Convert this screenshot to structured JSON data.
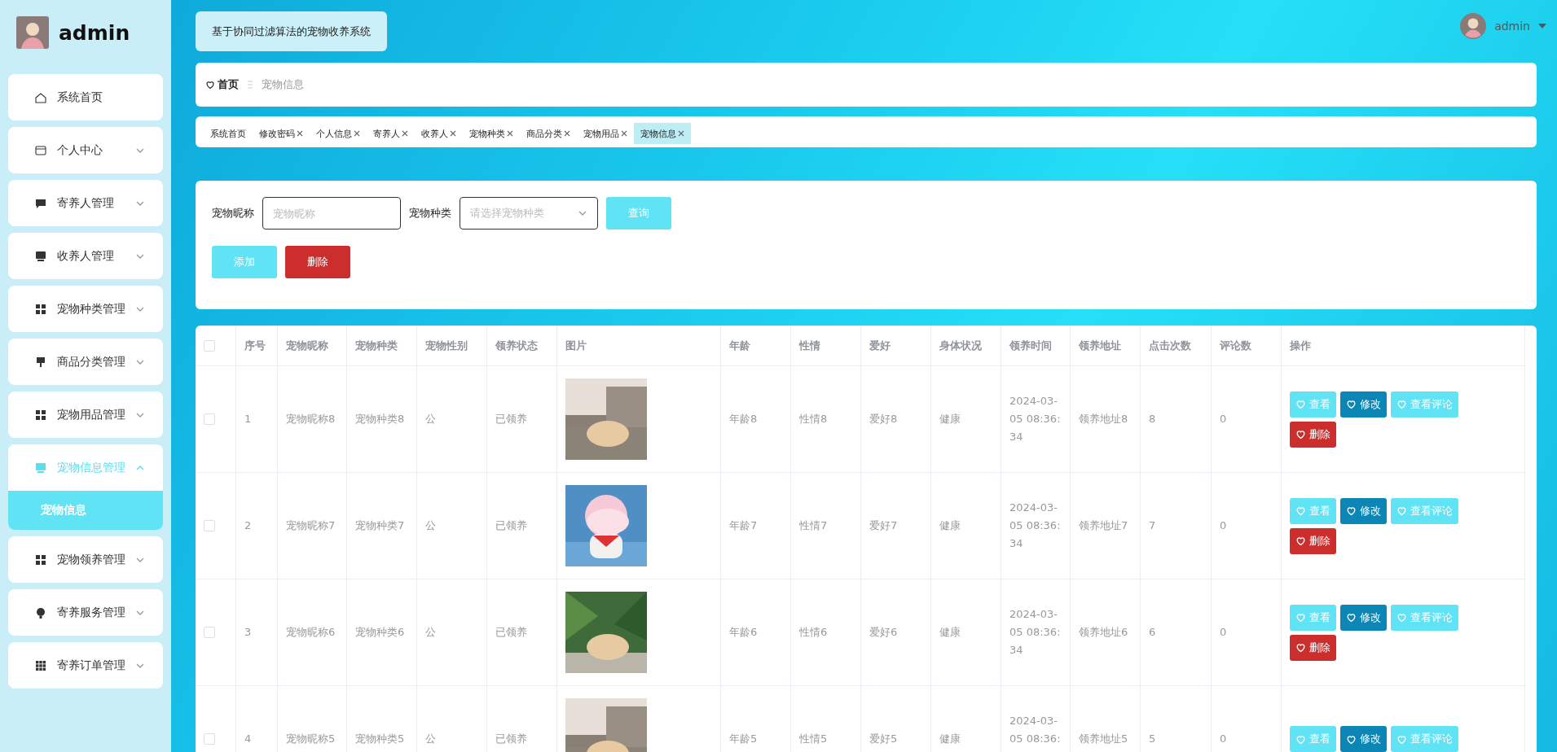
{
  "sidebar": {
    "title": "admin",
    "menu": [
      {
        "label": "系统首页",
        "kind": "link"
      },
      {
        "label": "个人中心",
        "kind": "group",
        "expanded": false
      },
      {
        "label": "寄养人管理",
        "kind": "group",
        "expanded": false
      },
      {
        "label": "收养人管理",
        "kind": "group",
        "expanded": false
      },
      {
        "label": "宠物种类管理",
        "kind": "group",
        "expanded": false
      },
      {
        "label": "商品分类管理",
        "kind": "group",
        "expanded": false
      },
      {
        "label": "宠物用品管理",
        "kind": "group",
        "expanded": false
      },
      {
        "label": "宠物信息管理",
        "kind": "group",
        "expanded": true,
        "children": [
          {
            "label": "宠物信息",
            "selected": true
          }
        ]
      },
      {
        "label": "宠物领养管理",
        "kind": "group",
        "expanded": false
      },
      {
        "label": "寄养服务管理",
        "kind": "group",
        "expanded": false
      },
      {
        "label": "寄养订单管理",
        "kind": "group",
        "expanded": false
      }
    ]
  },
  "header": {
    "system_title": "基于协同过滤算法的宠物收养系统",
    "user": "admin"
  },
  "breadcrumb": [
    {
      "label": "首页"
    },
    {
      "label": "宠物信息"
    }
  ],
  "tabs": [
    {
      "label": "系统首页",
      "closable": false,
      "selected": false
    },
    {
      "label": "修改密码",
      "closable": true,
      "selected": false
    },
    {
      "label": "个人信息",
      "closable": true,
      "selected": false
    },
    {
      "label": "寄养人",
      "closable": true,
      "selected": false
    },
    {
      "label": "收养人",
      "closable": true,
      "selected": false
    },
    {
      "label": "宠物种类",
      "closable": true,
      "selected": false
    },
    {
      "label": "商品分类",
      "closable": true,
      "selected": false
    },
    {
      "label": "宠物用品",
      "closable": true,
      "selected": false
    },
    {
      "label": "宠物信息",
      "closable": true,
      "selected": true
    }
  ],
  "search": {
    "fields": [
      {
        "label": "宠物昵称",
        "kind": "input",
        "placeholder": "宠物昵称"
      },
      {
        "label": "宠物种类",
        "kind": "select",
        "placeholder": "请选择宠物种类"
      }
    ],
    "query_button": "查询",
    "add_button": "添加",
    "delete_button": "删除"
  },
  "table": {
    "columns": [
      "序号",
      "宠物昵称",
      "宠物种类",
      "宠物性别",
      "领养状态",
      "图片",
      "年龄",
      "性情",
      "爱好",
      "身体状况",
      "领养时间",
      "领养地址",
      "点击次数",
      "评论数",
      "操作"
    ],
    "all_checked": false,
    "rows": [
      {
        "checked": false,
        "cells": [
          "1",
          "宠物昵称8",
          "宠物种类8",
          "公",
          "已领养",
          {
            "kind": "picture"
          },
          "年龄8",
          "性情8",
          "爱好8",
          "健康",
          "2024-03-05 08:36:34",
          "领养地址8",
          "8",
          "0"
        ],
        "actions": [
          {
            "label": "查看",
            "kind": "view"
          },
          {
            "label": "修改",
            "kind": "edit"
          },
          {
            "label": "查看评论",
            "kind": "view"
          },
          {
            "label": "删除",
            "kind": "delete"
          }
        ]
      },
      {
        "checked": false,
        "cells": [
          "2",
          "宠物昵称7",
          "宠物种类7",
          "公",
          "已领养",
          {
            "kind": "picture"
          },
          "年龄7",
          "性情7",
          "爱好7",
          "健康",
          "2024-03-05 08:36:34",
          "领养地址7",
          "7",
          "0"
        ],
        "actions": [
          {
            "label": "查看",
            "kind": "view"
          },
          {
            "label": "修改",
            "kind": "edit"
          },
          {
            "label": "查看评论",
            "kind": "view"
          },
          {
            "label": "删除",
            "kind": "delete"
          }
        ]
      },
      {
        "checked": false,
        "cells": [
          "3",
          "宠物昵称6",
          "宠物种类6",
          "公",
          "已领养",
          {
            "kind": "picture"
          },
          "年龄6",
          "性情6",
          "爱好6",
          "健康",
          "2024-03-05 08:36:34",
          "领养地址6",
          "6",
          "0"
        ],
        "actions": [
          {
            "label": "查看",
            "kind": "view"
          },
          {
            "label": "修改",
            "kind": "edit"
          },
          {
            "label": "查看评论",
            "kind": "view"
          },
          {
            "label": "删除",
            "kind": "delete"
          }
        ]
      },
      {
        "checked": false,
        "cells": [
          "4",
          "宠物昵称5",
          "宠物种类5",
          "公",
          "已领养",
          {
            "kind": "picture"
          },
          "年龄5",
          "性情5",
          "爱好5",
          "健康",
          "2024-03-05 08:36:",
          "领养地址5",
          "5",
          "0"
        ],
        "actions": [
          {
            "label": "查看",
            "kind": "view"
          },
          {
            "label": "修改",
            "kind": "edit"
          },
          {
            "label": "查看评论",
            "kind": "view"
          }
        ]
      }
    ]
  }
}
